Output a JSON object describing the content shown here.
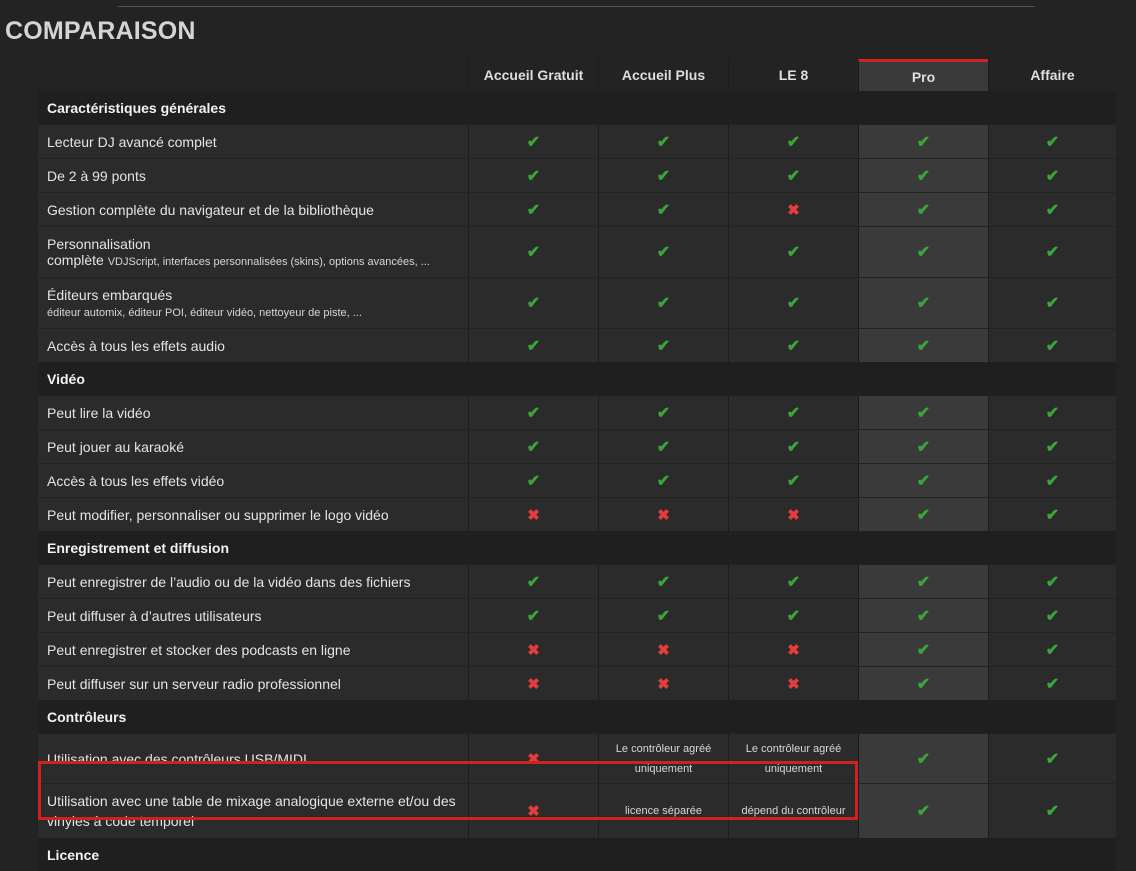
{
  "page": {
    "title": "COMPARAISON"
  },
  "columns": [
    "Accueil Gratuit",
    "Accueil Plus",
    "LE 8",
    "Pro",
    "Affaire"
  ],
  "sections": [
    {
      "title": "Caractéristiques générales",
      "rows": [
        {
          "label": "Lecteur DJ avancé complet",
          "cells": [
            "check",
            "check",
            "check",
            "check",
            "check"
          ]
        },
        {
          "label": "De 2 à 99 ponts",
          "cells": [
            "check",
            "check",
            "check",
            "check",
            "check"
          ]
        },
        {
          "label": "Gestion complète du navigateur et de la bibliothèque",
          "cells": [
            "check",
            "check",
            "cross",
            "check",
            "check"
          ]
        },
        {
          "label": "Personnalisation",
          "label2": "complète",
          "sub": "VDJScript, interfaces personnalisées (skins), options avancées, ...",
          "cells": [
            "check",
            "check",
            "check",
            "check",
            "check"
          ]
        },
        {
          "label": "Éditeurs embarqués",
          "sub": "éditeur automix, éditeur POI, éditeur vidéo, nettoyeur de piste, ...",
          "cells": [
            "check",
            "check",
            "check",
            "check",
            "check"
          ]
        },
        {
          "label": "Accès à tous les effets audio",
          "cells": [
            "check",
            "check",
            "check",
            "check",
            "check"
          ]
        }
      ]
    },
    {
      "title": "Vidéo",
      "rows": [
        {
          "label": "Peut lire la vidéo",
          "cells": [
            "check",
            "check",
            "check",
            "check",
            "check"
          ]
        },
        {
          "label": "Peut jouer au karaoké",
          "cells": [
            "check",
            "check",
            "check",
            "check",
            "check"
          ]
        },
        {
          "label": "Accès à tous les effets vidéo",
          "cells": [
            "check",
            "check",
            "check",
            "check",
            "check"
          ]
        },
        {
          "label": "Peut modifier, personnaliser ou supprimer le logo vidéo",
          "cells": [
            "cross",
            "cross",
            "cross",
            "check",
            "check"
          ]
        }
      ]
    },
    {
      "title": "Enregistrement et diffusion",
      "rows": [
        {
          "label": "Peut enregistrer de l’audio ou de la vidéo dans des fichiers",
          "cells": [
            "check",
            "check",
            "check",
            "check",
            "check"
          ]
        },
        {
          "label": "Peut diffuser à d’autres utilisateurs",
          "cells": [
            "check",
            "check",
            "check",
            "check",
            "check"
          ]
        },
        {
          "label": "Peut enregistrer et stocker des podcasts en ligne",
          "cells": [
            "cross",
            "cross",
            "cross",
            "check",
            "check"
          ]
        },
        {
          "label": "Peut diffuser sur un serveur radio professionnel",
          "cells": [
            "cross",
            "cross",
            "cross",
            "check",
            "check"
          ]
        }
      ]
    },
    {
      "title": "Contrôleurs",
      "rows": [
        {
          "label": "Utilisation avec des contrôleurs USB/MIDI",
          "cells": [
            "cross",
            "Le contrôleur agréé uniquement",
            "Le contrôleur agréé uniquement",
            "check",
            "check"
          ]
        },
        {
          "label": "Utilisation avec une table de mixage analogique externe et/ou des vinyles à code temporel",
          "cells": [
            "cross",
            "licence séparée",
            "dépend du contrôleur",
            "check",
            "check"
          ]
        }
      ]
    },
    {
      "title": "Licence",
      "rows": []
    }
  ],
  "glyphs": {
    "check": "✔",
    "cross": "✖"
  },
  "colors": {
    "check": "#3aa63a",
    "cross": "#e33d3d",
    "highlight": "#d0201f",
    "pro_column": "#3a3a3a"
  }
}
